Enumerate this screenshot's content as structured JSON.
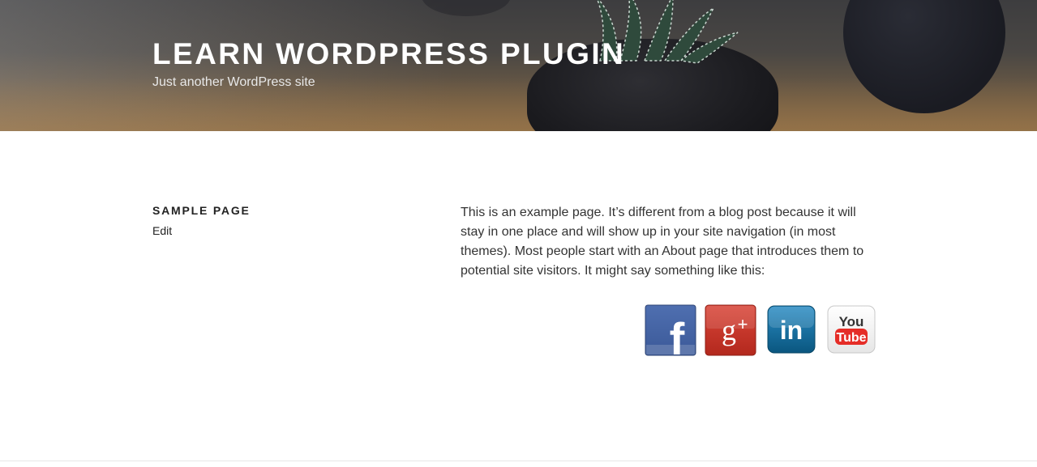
{
  "header": {
    "site_title": "LEARN WORDPRESS PLUGIN",
    "tagline": "Just another WordPress site"
  },
  "page": {
    "title": "SAMPLE PAGE",
    "edit_label": "Edit",
    "body": "This is an example page. It’s different from a blog post because it will stay in one place and will show up in your site navigation (in most themes). Most people start with an About page that introduces them to potential site visitors. It might say something like this:"
  },
  "social": {
    "items": [
      {
        "icon": "facebook-icon",
        "glyph": "f",
        "color": "#3b5998"
      },
      {
        "icon": "google-plus-icon",
        "glyph": "g+",
        "color": "#c0392b"
      },
      {
        "icon": "linkedin-icon",
        "glyph": "in",
        "color": "#0e6797"
      },
      {
        "icon": "youtube-icon",
        "glyph_top": "You",
        "glyph_bottom": "Tube",
        "color": "#e52d27"
      }
    ]
  },
  "colors": {
    "title_text": "#ffffff",
    "body_text": "#333333",
    "facebook": "#3b5998",
    "google_plus": "#c0392b",
    "linkedin": "#0e6797",
    "youtube": "#e52d27"
  }
}
